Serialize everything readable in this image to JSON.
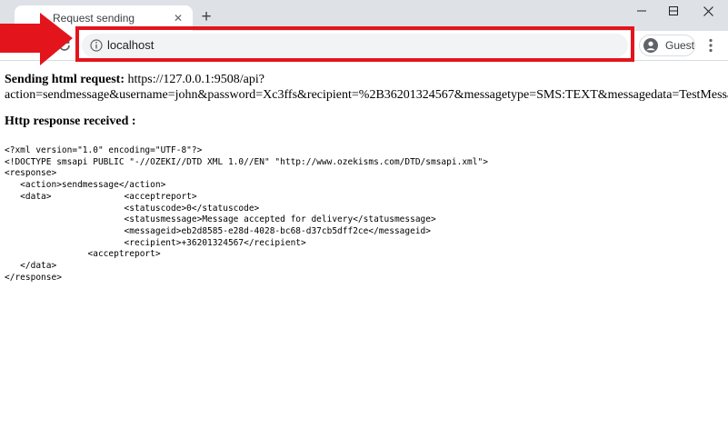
{
  "tab": {
    "title": "Request sending"
  },
  "toolbar": {
    "url": "localhost",
    "profile_label": "Guest"
  },
  "page": {
    "request_label": "Sending html request:",
    "request_url_line1": "https://127.0.0.1:9508/api?",
    "request_url_line2": "action=sendmessage&username=john&password=Xc3ffs&recipient=%2B36201324567&messagetype=SMS:TEXT&messagedata=TestMessage",
    "response_label": "Http response received :",
    "xml_lines": [
      "<?xml version=\"1.0\" encoding=\"UTF-8\"?>",
      "<!DOCTYPE smsapi PUBLIC \"-//OZEKI//DTD XML 1.0//EN\" \"http://www.ozekisms.com/DTD/smsapi.xml\">",
      "<response>",
      "   <action>sendmessage</action>",
      "   <data>              <acceptreport>",
      "                       <statuscode>0</statuscode>",
      "                       <statusmessage>Message accepted for delivery</statusmessage>",
      "                       <messageid>eb2d8585-e28d-4028-bc68-d37cb5dff2ce</messageid>",
      "                       <recipient>+36201324567</recipient>",
      "                <acceptreport>",
      "   </data>",
      "</response>"
    ]
  },
  "colors": {
    "highlight": "#e3141c",
    "titlebar": "#dee1e6",
    "omnibox": "#f1f3f4"
  }
}
